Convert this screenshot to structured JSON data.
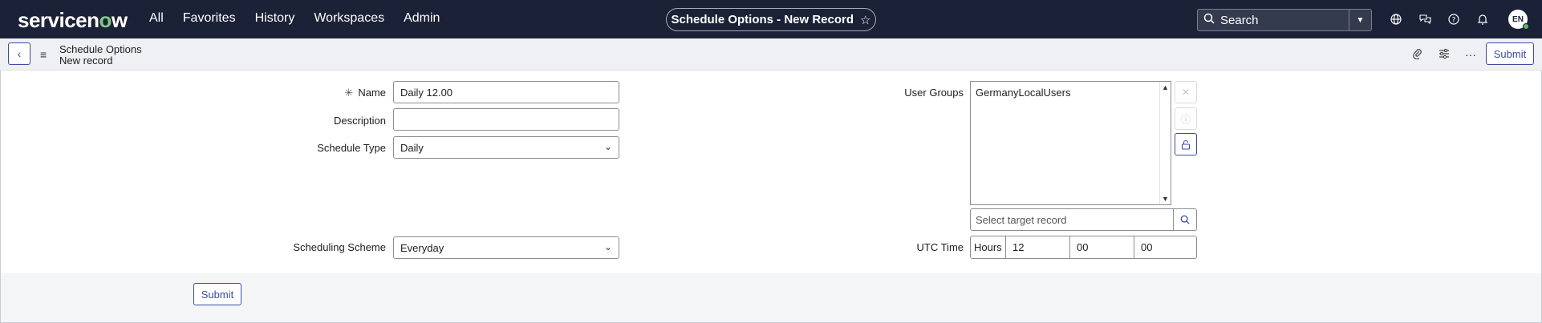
{
  "nav": {
    "logo": "servicenow",
    "links": [
      "All",
      "Favorites",
      "History",
      "Workspaces",
      "Admin"
    ],
    "record_title": "Schedule Options - New Record",
    "search_placeholder": "Search",
    "avatar_initials": "EN"
  },
  "subbar": {
    "breadcrumb_title": "Schedule Options",
    "breadcrumb_subtitle": "New record",
    "submit_label": "Submit"
  },
  "form": {
    "name_label": "Name",
    "name_value": "Daily 12.00",
    "description_label": "Description",
    "description_value": "",
    "schedule_type_label": "Schedule Type",
    "schedule_type_value": "Daily",
    "scheduling_scheme_label": "Scheduling Scheme",
    "scheduling_scheme_value": "Everyday",
    "user_groups_label": "User Groups",
    "user_groups_items": [
      "GermanyLocalUsers"
    ],
    "target_placeholder": "Select target record",
    "utc_time_label": "UTC Time",
    "utc_hours_label": "Hours",
    "utc_hours": "12",
    "utc_minutes": "00",
    "utc_seconds": "00",
    "submit_label": "Submit"
  },
  "colors": {
    "nav_bg": "#1b2136",
    "accent": "#3a4ba3"
  }
}
